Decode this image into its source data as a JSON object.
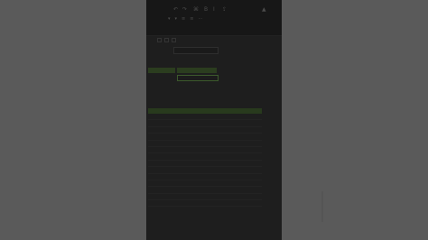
{
  "window": {
    "background_color": "#5a5a5a",
    "frame_color": "#1c1c1c",
    "accent_green": "#2b3d1f"
  },
  "topbar": {
    "icons": [
      "undo-icon",
      "redo-icon",
      "format-icon",
      "bold-icon",
      "italic-icon",
      "share-icon"
    ],
    "glyphs": [
      "↶",
      "↷",
      "⌘",
      "B",
      "I",
      "⇪",
      "▲"
    ]
  },
  "toolbar": {
    "items": [
      "▾",
      "▾",
      "≡",
      "≡",
      "⋯"
    ]
  },
  "form": {
    "header_left": "",
    "header_right": "",
    "label": "",
    "input_value": ""
  },
  "table": {
    "headers": [
      "",
      "",
      ""
    ],
    "rows": [
      [
        "",
        "",
        ""
      ],
      [
        "",
        "",
        ""
      ],
      [
        "",
        "",
        ""
      ],
      [
        "",
        "",
        ""
      ],
      [
        "",
        "",
        ""
      ],
      [
        "",
        "",
        ""
      ],
      [
        "",
        "",
        ""
      ],
      [
        "",
        "",
        ""
      ],
      [
        "",
        "",
        ""
      ],
      [
        "",
        "",
        ""
      ],
      [
        "",
        "",
        ""
      ],
      [
        "",
        "",
        ""
      ],
      [
        "",
        "",
        ""
      ],
      [
        "",
        "",
        ""
      ]
    ]
  }
}
